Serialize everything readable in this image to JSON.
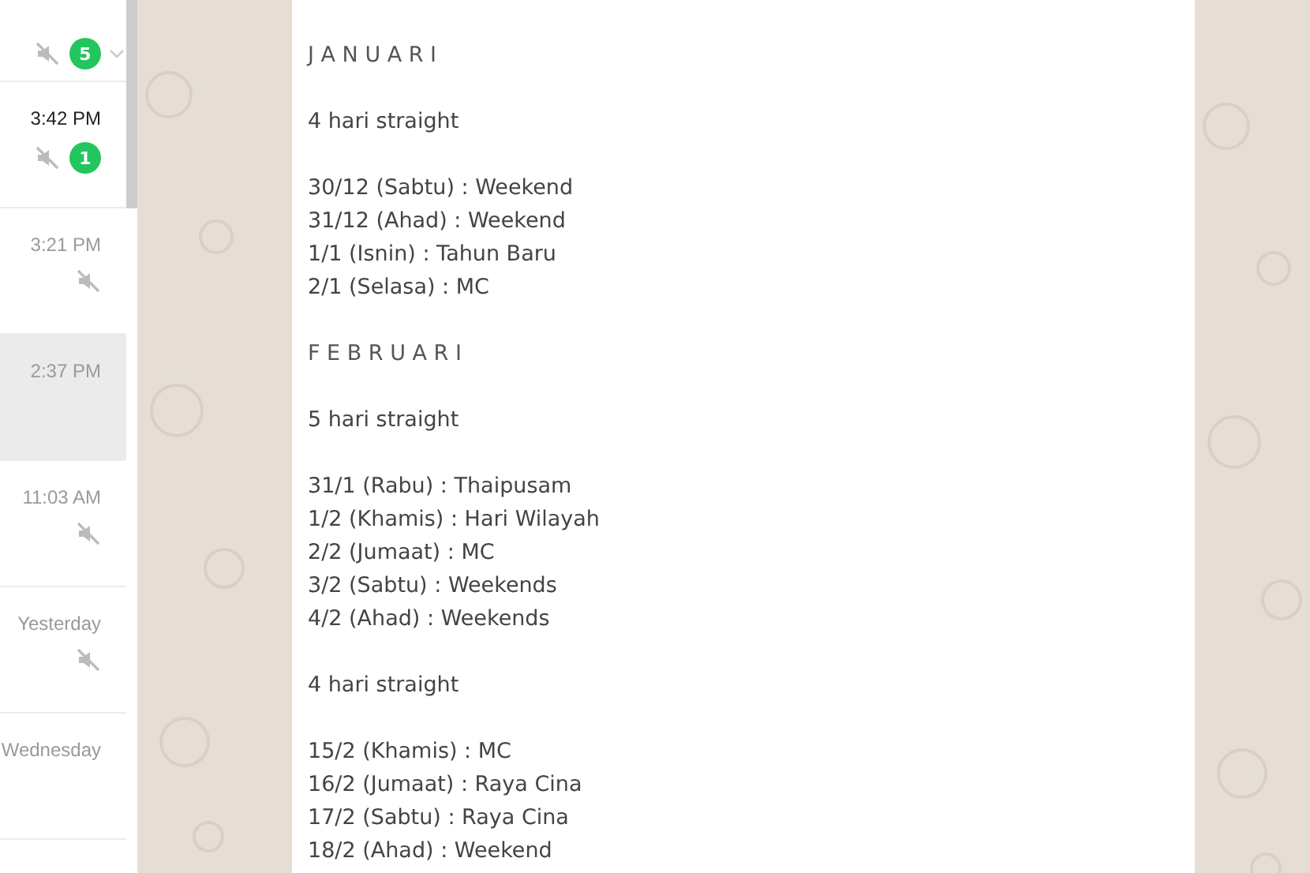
{
  "chats": [
    {
      "muted": true,
      "unread": "5",
      "selected": false,
      "menu": true
    },
    {
      "time": "3:42 PM",
      "muted": true,
      "unread": "1",
      "selected": false,
      "bold_time": true,
      "menu": false
    },
    {
      "time": "3:21 PM",
      "muted": true,
      "selected": false,
      "bold_time": false,
      "menu": false
    },
    {
      "time": "2:37 PM",
      "muted": false,
      "selected": true,
      "bold_time": false,
      "menu": false
    },
    {
      "time": "11:03 AM",
      "muted": true,
      "selected": false,
      "bold_time": false,
      "menu": false
    },
    {
      "time": "Yesterday",
      "muted": true,
      "selected": false,
      "bold_time": false,
      "menu": false
    },
    {
      "time": "Wednesday",
      "muted": false,
      "selected": false,
      "bold_time": false,
      "menu": false
    }
  ],
  "message": {
    "lines": [
      {
        "kind": "heading",
        "text": "J A N U A R I"
      },
      {
        "kind": "gap"
      },
      {
        "kind": "text",
        "text": "4 hari straight"
      },
      {
        "kind": "gap"
      },
      {
        "kind": "text",
        "text": "30/12 (Sabtu) : Weekend"
      },
      {
        "kind": "text",
        "text": "31/12 (Ahad) : Weekend"
      },
      {
        "kind": "text",
        "text": "1/1 (Isnin) : Tahun Baru"
      },
      {
        "kind": "text",
        "text": "2/1 (Selasa) : MC"
      },
      {
        "kind": "gap"
      },
      {
        "kind": "heading",
        "text": "F E B R U A R I"
      },
      {
        "kind": "gap"
      },
      {
        "kind": "text",
        "text": "5 hari straight"
      },
      {
        "kind": "gap"
      },
      {
        "kind": "text",
        "text": "31/1 (Rabu) : Thaipusam"
      },
      {
        "kind": "text",
        "text": "1/2 (Khamis) : Hari Wilayah"
      },
      {
        "kind": "text",
        "text": "2/2 (Jumaat) : MC"
      },
      {
        "kind": "text",
        "text": "3/2 (Sabtu) : Weekends"
      },
      {
        "kind": "text",
        "text": "4/2 (Ahad) : Weekends"
      },
      {
        "kind": "gap"
      },
      {
        "kind": "text",
        "text": "4 hari straight"
      },
      {
        "kind": "gap"
      },
      {
        "kind": "text",
        "text": "15/2 (Khamis) : MC"
      },
      {
        "kind": "text",
        "text": "16/2 (Jumaat) : Raya Cina"
      },
      {
        "kind": "text",
        "text": "17/2 (Sabtu) : Raya Cina"
      },
      {
        "kind": "text",
        "text": "18/2 (Ahad) : Weekend"
      }
    ]
  }
}
